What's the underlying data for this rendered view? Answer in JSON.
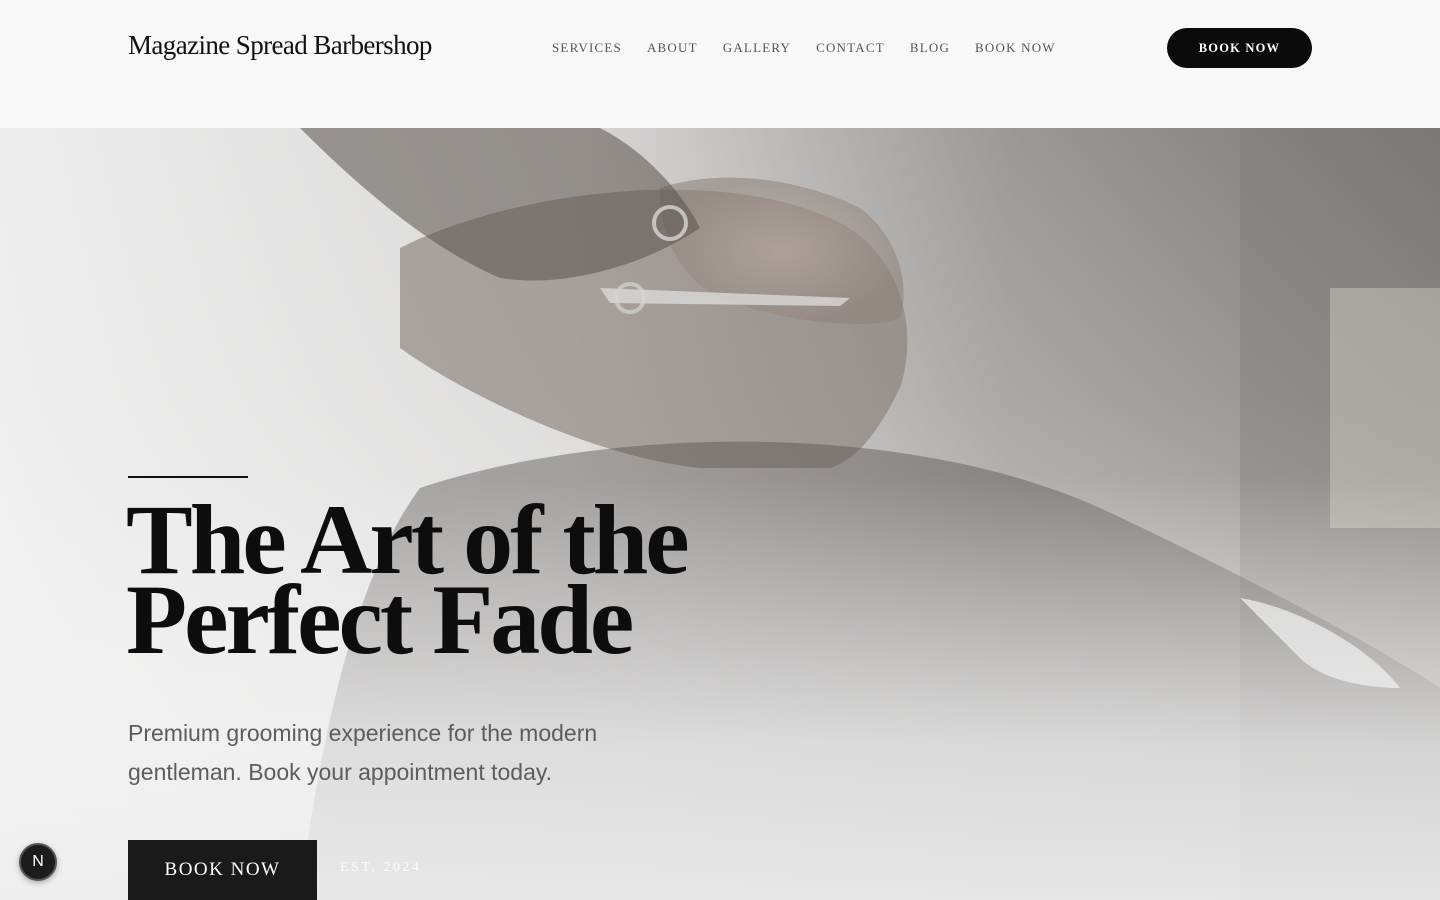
{
  "header": {
    "brand": "Magazine Spread Barbershop",
    "nav": [
      "SERVICES",
      "ABOUT",
      "GALLERY",
      "CONTACT",
      "BLOG",
      "BOOK NOW"
    ],
    "cta": "BOOK NOW"
  },
  "hero": {
    "headline_line1": "The Art of the",
    "headline_line2": "Perfect Fade",
    "subtitle": "Premium grooming experience for the modern gentleman. Book your appointment today.",
    "cta": "BOOK NOW",
    "est": "EST. 2024"
  },
  "badge": {
    "letter": "N",
    "icon": "next-js-icon"
  },
  "colors": {
    "accent": "#0b0b0b",
    "background": "#f8f8f8",
    "subtitle": "#5d5d5d"
  }
}
